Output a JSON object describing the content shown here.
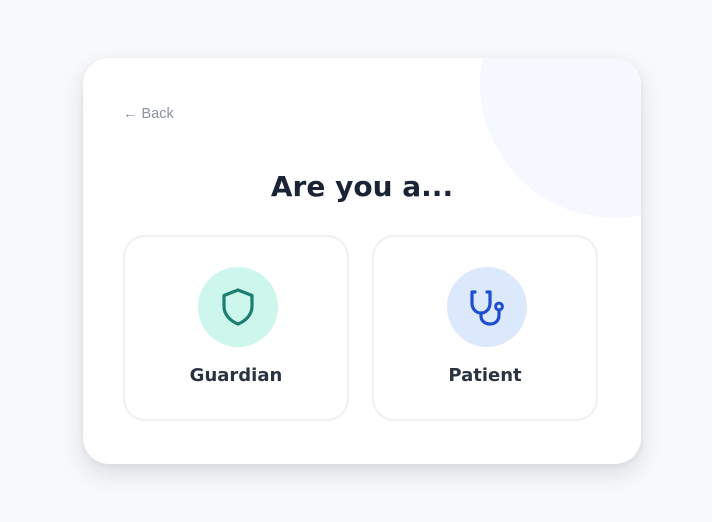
{
  "back": {
    "arrow": "←",
    "label": "Back"
  },
  "title": "Are you a...",
  "options": [
    {
      "label": "Guardian",
      "icon": "shield-icon",
      "icon_color": "#1a7f6e",
      "icon_bg": "#cdf6ec"
    },
    {
      "label": "Patient",
      "icon": "stethoscope-icon",
      "icon_color": "#1f4fd1",
      "icon_bg": "#dce8fc"
    }
  ],
  "colors": {
    "page_bg": "#f8f9fb",
    "card_bg": "#ffffff",
    "title": "#1b2434",
    "muted": "#8a93a3"
  }
}
